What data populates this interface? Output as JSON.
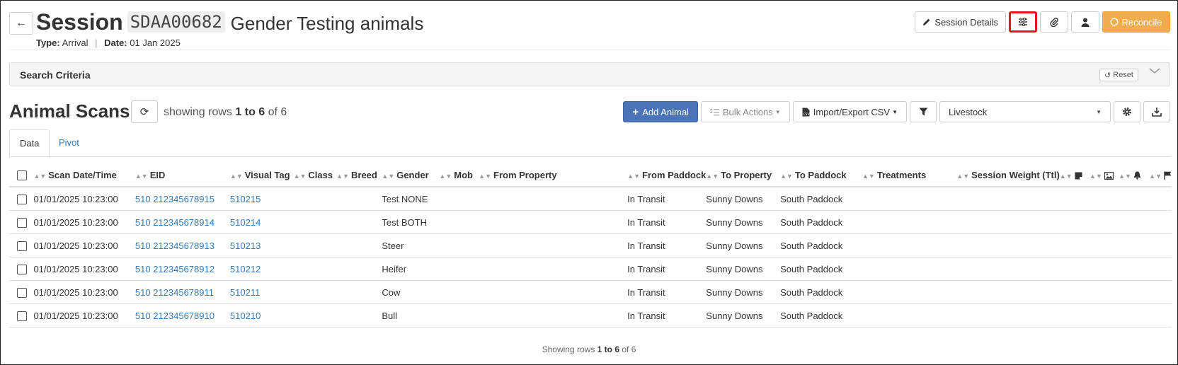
{
  "header": {
    "title_word": "Session",
    "session_code": "SDAA00682",
    "session_name": "Gender Testing animals",
    "type_label": "Type:",
    "type_value": "Arrival",
    "date_label": "Date:",
    "date_value": "01 Jan 2025",
    "session_details_label": "Session Details",
    "reconcile_label": "Reconcile"
  },
  "criteria": {
    "title": "Search Criteria",
    "reset_label": "Reset"
  },
  "scans": {
    "title": "Animal Scans",
    "showing_prefix": "showing rows",
    "showing_range": "1 to 6",
    "showing_suffix": "of 6"
  },
  "toolbar": {
    "add_animal_label": "Add Animal",
    "bulk_actions_label": "Bulk Actions",
    "import_export_label": "Import/Export CSV",
    "select_value": "Livestock"
  },
  "tabs": [
    {
      "label": "Data"
    },
    {
      "label": "Pivot"
    }
  ],
  "table": {
    "columns": [
      "Scan Date/Time",
      "EID",
      "Visual Tag",
      "Class",
      "Breed",
      "Gender",
      "Mob",
      "From Property",
      "From Paddock",
      "To Property",
      "To Paddock",
      "Treatments",
      "Session Weight (Ttl)"
    ],
    "rows": [
      {
        "datetime": "01/01/2025 10:23:00",
        "eid": "510 212345678915",
        "visual_tag": "510215",
        "class": "",
        "breed": "",
        "gender": "Test NONE",
        "mob": "",
        "from_property": "",
        "from_paddock": "In Transit",
        "to_property": "Sunny Downs",
        "to_paddock": "South Paddock",
        "treatments": "",
        "weight": ""
      },
      {
        "datetime": "01/01/2025 10:23:00",
        "eid": "510 212345678914",
        "visual_tag": "510214",
        "class": "",
        "breed": "",
        "gender": "Test BOTH",
        "mob": "",
        "from_property": "",
        "from_paddock": "In Transit",
        "to_property": "Sunny Downs",
        "to_paddock": "South Paddock",
        "treatments": "",
        "weight": ""
      },
      {
        "datetime": "01/01/2025 10:23:00",
        "eid": "510 212345678913",
        "visual_tag": "510213",
        "class": "",
        "breed": "",
        "gender": "Steer",
        "mob": "",
        "from_property": "",
        "from_paddock": "In Transit",
        "to_property": "Sunny Downs",
        "to_paddock": "South Paddock",
        "treatments": "",
        "weight": ""
      },
      {
        "datetime": "01/01/2025 10:23:00",
        "eid": "510 212345678912",
        "visual_tag": "510212",
        "class": "",
        "breed": "",
        "gender": "Heifer",
        "mob": "",
        "from_property": "",
        "from_paddock": "In Transit",
        "to_property": "Sunny Downs",
        "to_paddock": "South Paddock",
        "treatments": "",
        "weight": ""
      },
      {
        "datetime": "01/01/2025 10:23:00",
        "eid": "510 212345678911",
        "visual_tag": "510211",
        "class": "",
        "breed": "",
        "gender": "Cow",
        "mob": "",
        "from_property": "",
        "from_paddock": "In Transit",
        "to_property": "Sunny Downs",
        "to_paddock": "South Paddock",
        "treatments": "",
        "weight": ""
      },
      {
        "datetime": "01/01/2025 10:23:00",
        "eid": "510 212345678910",
        "visual_tag": "510210",
        "class": "",
        "breed": "",
        "gender": "Bull",
        "mob": "",
        "from_property": "",
        "from_paddock": "In Transit",
        "to_property": "Sunny Downs",
        "to_paddock": "South Paddock",
        "treatments": "",
        "weight": ""
      }
    ]
  },
  "footer": {
    "prefix": "Showing rows",
    "range": "1 to 6",
    "suffix": "of 6"
  },
  "icons": {
    "back": "arrow-left-icon",
    "session_details": "pencil-icon",
    "settings": "sliders-icon",
    "attach": "paperclip-icon",
    "user": "user-icon",
    "reconcile": "circle-icon",
    "reset": "undo-icon",
    "collapse": "chevron-down-icon",
    "refresh": "refresh-icon",
    "add": "plus-icon",
    "bulk": "list-check-icon",
    "csv": "file-csv-icon",
    "filter": "filter-icon",
    "gear": "gear-icon",
    "download": "download-icon",
    "note": "note-icon",
    "image": "image-icon",
    "bell": "bell-icon",
    "flag": "flag-icon"
  },
  "colors": {
    "primary": "#4a74b7",
    "reconcile": "#f0ad4e",
    "link": "#337ab7",
    "highlight": "#e0191b"
  }
}
